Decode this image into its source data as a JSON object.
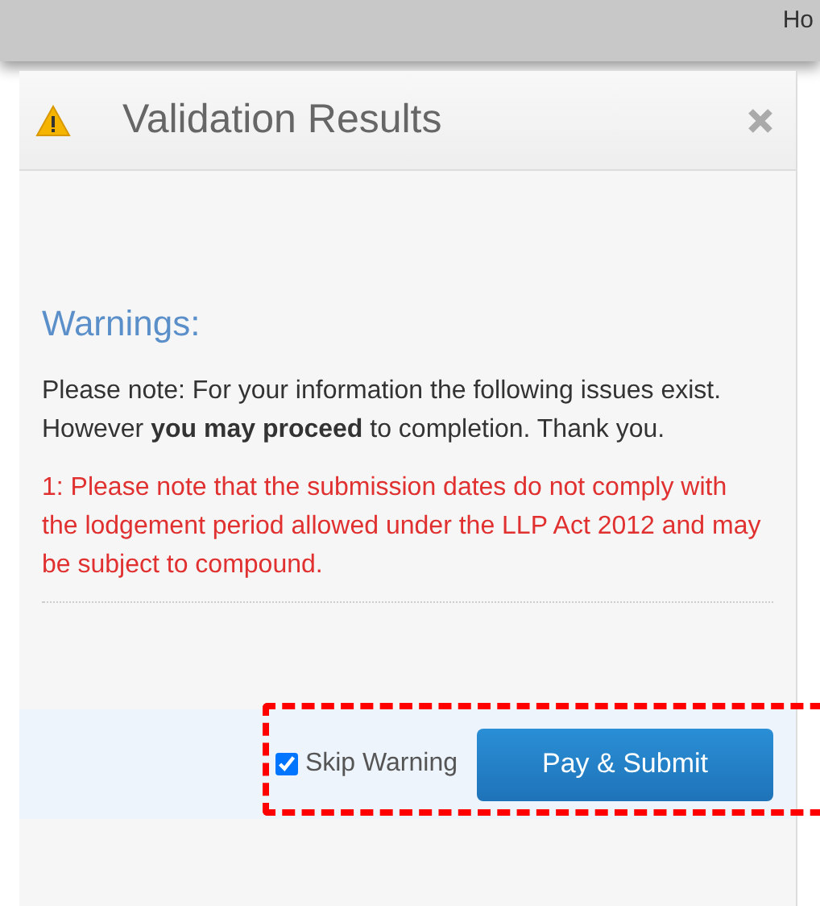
{
  "top_bar": {
    "text": "Ho"
  },
  "dialog": {
    "title": "Validation Results",
    "section_heading": "Warnings:",
    "note": "Please note: For your information the following issues exist. However **you may proceed** to completion. Thank you.",
    "warnings": [
      "1: Please note that the submission dates do not comply with the lodgement period allowed under the LLP Act 2012 and may be subject to compound."
    ],
    "skip_warning": {
      "label": "Skip Warning",
      "checked": true
    },
    "submit_button": "Pay & Submit",
    "highlighted": true
  }
}
